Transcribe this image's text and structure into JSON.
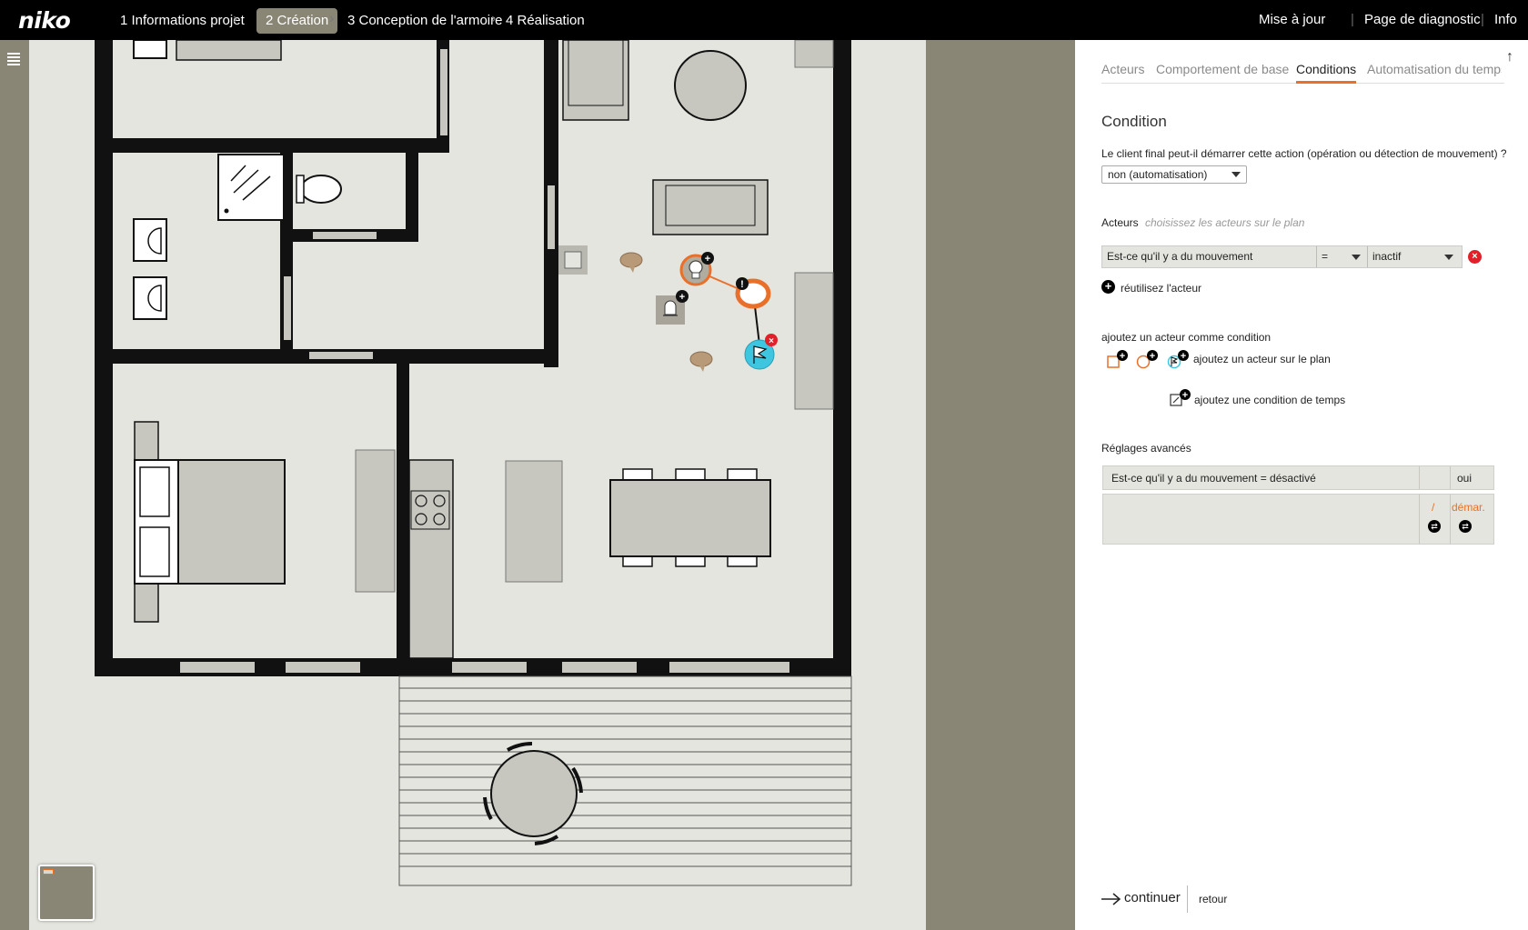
{
  "app": {
    "logo": "niko"
  },
  "steps": [
    {
      "label": "1 Informations projet"
    },
    {
      "label": "2 Création"
    },
    {
      "label": "3 Conception de l'armoire"
    },
    {
      "label": "4 Réalisation"
    }
  ],
  "top_links": [
    {
      "label": "Mise à jour"
    },
    {
      "label": "Page de diagnostic"
    },
    {
      "label": "Info"
    }
  ],
  "tabs": [
    {
      "label": "Acteurs"
    },
    {
      "label": "Comportement de base"
    },
    {
      "label": "Conditions"
    },
    {
      "label": "Automatisation du temps"
    }
  ],
  "condition": {
    "title": "Condition",
    "question": "Le client final peut-il démarrer cette action (opération ou détection de mouvement) ?",
    "mode_selected": "non (automatisation)",
    "actors_label": "Acteurs",
    "actors_hint": "choisissez les acteurs sur le plan",
    "row": {
      "subject": "Est-ce qu'il y a du mouvement",
      "operator": "=",
      "value": "inactif"
    },
    "reuse_label": "réutilisez l'acteur",
    "add_actor_label": "ajoutez un acteur comme condition",
    "add_plan_label": "ajoutez un acteur sur le plan",
    "add_time_label": "ajoutez une condition de temps"
  },
  "advanced": {
    "label": "Réglages avancés",
    "row_text": "Est-ce qu'il y a du mouvement = désactivé",
    "row_value": "oui",
    "slash": "/",
    "start_label": "démar."
  },
  "footer": {
    "continue": "continuer",
    "back": "retour"
  },
  "colors": {
    "accent": "#e8702a",
    "plan_bg": "#e5e5df",
    "furniture": "#c7c7bf",
    "panel_bg": "#ffffff",
    "olive": "#8a8676",
    "cyan": "#3ec6e0",
    "danger": "#e3202a"
  }
}
